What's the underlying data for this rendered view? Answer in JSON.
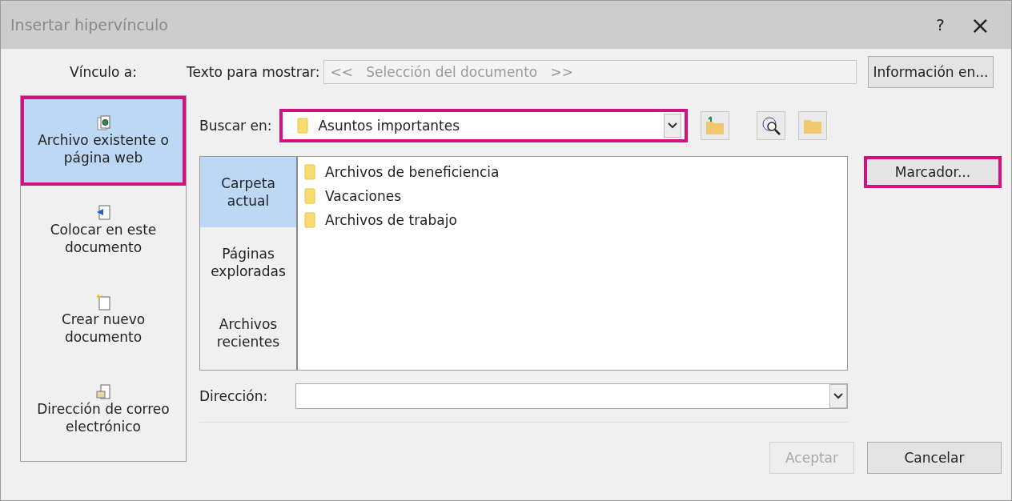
{
  "window": {
    "title": "Insertar hipervínculo",
    "help": "?",
    "close": "×"
  },
  "link_to_label": "Vínculo a:",
  "display_text": {
    "label": "Texto para mostrar:",
    "value": "<<   Selección del documento   >>",
    "disabled": true
  },
  "screen_tip_button": "Información en...",
  "sidebar": {
    "items": [
      {
        "label": "Archivo existente o página web",
        "kind": "file",
        "selected": true,
        "highlighted": true
      },
      {
        "label": "Colocar en este documento",
        "kind": "place",
        "selected": false,
        "highlighted": false
      },
      {
        "label": "Crear nuevo documento",
        "kind": "new",
        "selected": false,
        "highlighted": false
      },
      {
        "label": "Dirección de correo electrónico",
        "kind": "mail",
        "selected": false,
        "highlighted": false
      }
    ]
  },
  "look_in": {
    "label": "Buscar en:",
    "value": "Asuntos importantes",
    "highlighted": true
  },
  "browser_tabs": [
    {
      "label": "Carpeta actual",
      "selected": true
    },
    {
      "label": "Páginas exploradas",
      "selected": false
    },
    {
      "label": "Archivos recientes",
      "selected": false
    }
  ],
  "files": [
    {
      "name": "Archivos de beneficiencia"
    },
    {
      "name": "Vacaciones"
    },
    {
      "name": "Archivos de trabajo"
    }
  ],
  "bookmark_button": {
    "label": "Marcador...",
    "highlighted": true
  },
  "address": {
    "label": "Dirección:"
  },
  "buttons": [
    {
      "label": "Aceptar",
      "disabled": true
    },
    {
      "label": "Cancelar",
      "disabled": false
    }
  ]
}
